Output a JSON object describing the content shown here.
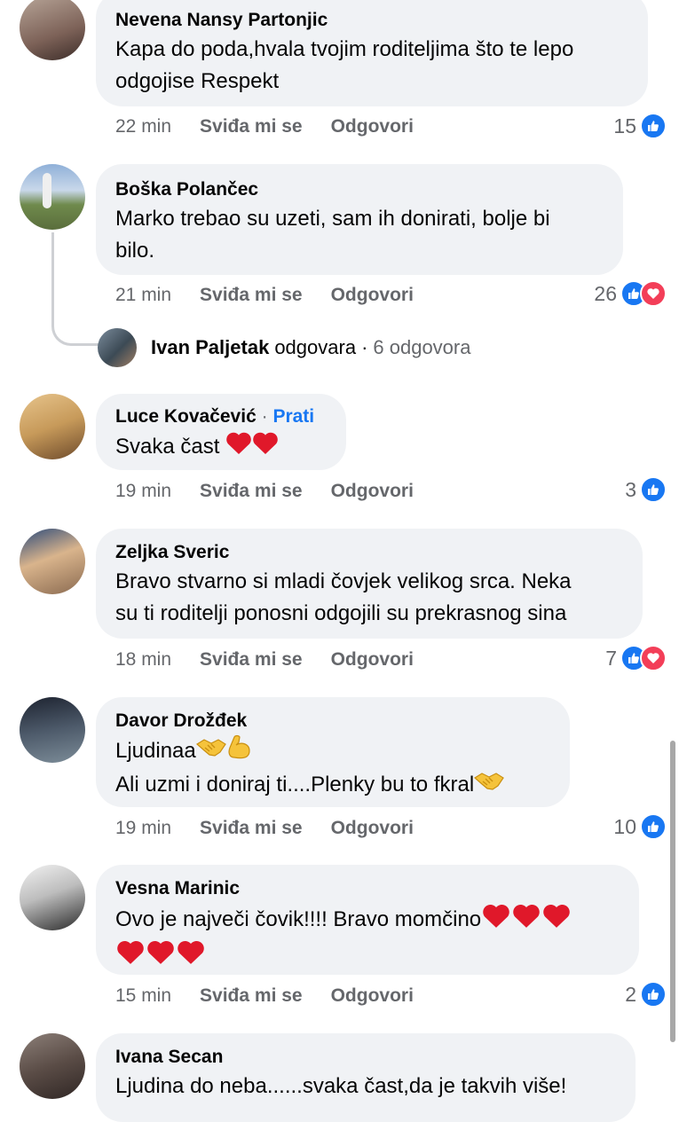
{
  "comments": [
    {
      "author": "Nevena Nansy Partonjic",
      "lines": [
        "Kapa do poda,hvala tvojim roditeljima što te lepo",
        "odgojise Respekt"
      ],
      "time": "22 min",
      "like": "Sviđa mi se",
      "reply": "Odgovori",
      "reactions": "15"
    },
    {
      "author": "Boška Polančec",
      "lines": [
        "Marko trebao su uzeti, sam ih donirati, bolje bi",
        "bilo."
      ],
      "time": "21 min",
      "like": "Sviđa mi se",
      "reply": "Odgovori",
      "reactions": "26"
    },
    {
      "author": "Luce Kovačević",
      "follow": "Prati",
      "lines": [
        "Svaka čast"
      ],
      "time": "19 min",
      "like": "Sviđa mi se",
      "reply": "Odgovori",
      "reactions": "3"
    },
    {
      "author": "Zeljka Sveric",
      "lines": [
        "Bravo stvarno si mladi čovjek velikog srca. Neka",
        "su ti roditelji ponosni odgojili su prekrasnog sina"
      ],
      "time": "18 min",
      "like": "Sviđa mi se",
      "reply": "Odgovori",
      "reactions": "7"
    },
    {
      "author": "Davor Drožđek",
      "lines": [
        "Ljudinaa",
        "Ali uzmi i doniraj ti....Plenky bu to fkral"
      ],
      "time": "19 min",
      "like": "Sviđa mi se",
      "reply": "Odgovori",
      "reactions": "10"
    },
    {
      "author": "Vesna Marinic",
      "lines": [
        "Ovo je največi čovik!!!! Bravo momčino",
        ""
      ],
      "time": "15 min",
      "like": "Sviđa mi se",
      "reply": "Odgovori",
      "reactions": "2"
    },
    {
      "author": "Ivana Secan",
      "lines": [
        "Ljudina do neba......svaka čast,da je takvih više!"
      ]
    }
  ],
  "reply_thread": {
    "name": "Ivan Paljetak",
    "action": "odgovara",
    "count": "6 odgovora"
  },
  "colors": {
    "accent": "#1877f2",
    "love": "#f33e58",
    "bubble": "#f0f2f5",
    "meta": "#65676b"
  },
  "icons": [
    "like-reaction-icon",
    "love-reaction-icon",
    "heart-emoji",
    "handshake-emoji",
    "flexed-biceps-emoji"
  ]
}
